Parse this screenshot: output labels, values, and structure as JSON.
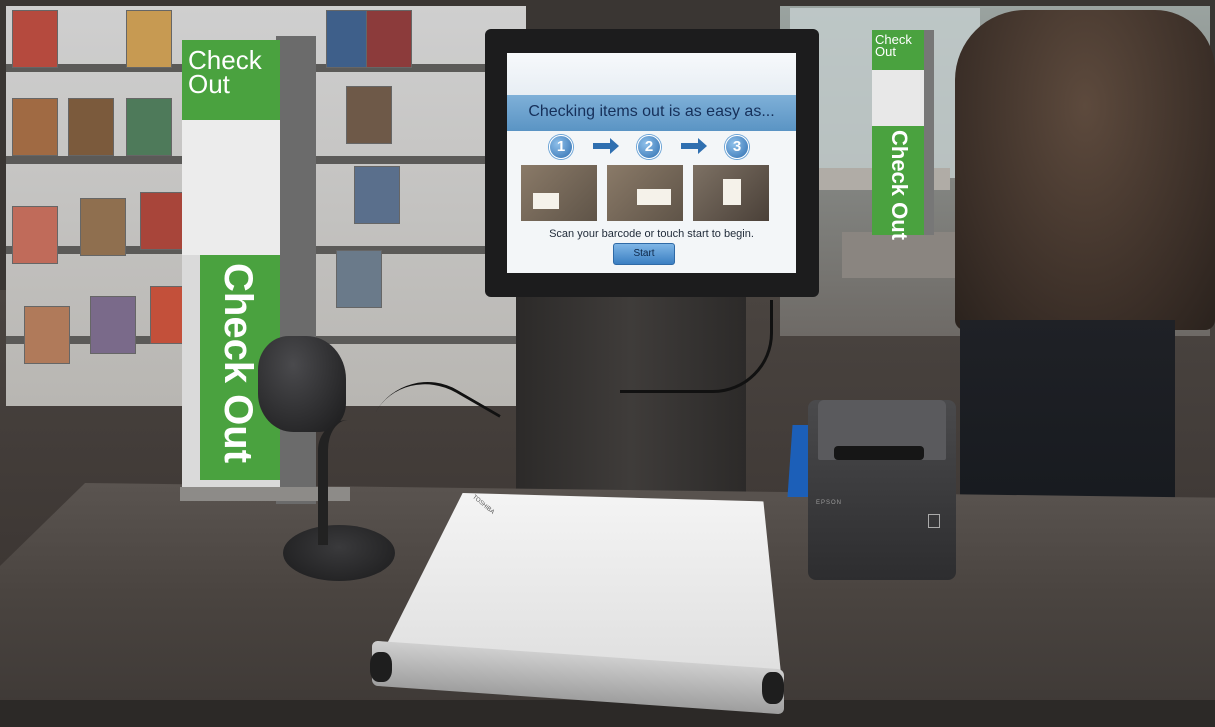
{
  "scene": {
    "monitor_screen": {
      "heading": "Checking items out is as easy as...",
      "steps": [
        "1",
        "2",
        "3"
      ],
      "instruction": "Scan your barcode or touch start to begin.",
      "start_button": "Start"
    },
    "signs": {
      "left_top": "Check Out",
      "left_vertical": "Check Out",
      "right_top": "Check Out",
      "right_vertical": "Check Out"
    },
    "printer_brand": "EPSON",
    "pad_brand": "TOSHIBA",
    "colors": {
      "sign_green": "#4aa23f",
      "screen_banner": "#5a94c4",
      "desk": "#4a4440"
    }
  }
}
